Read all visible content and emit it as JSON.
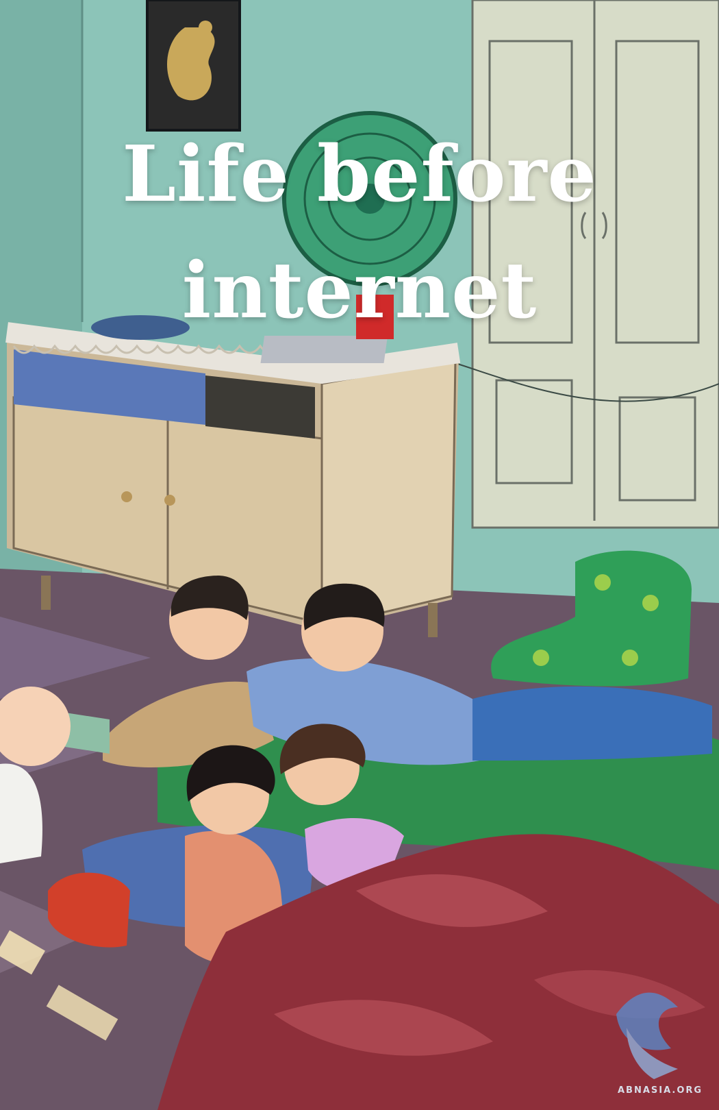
{
  "headline": {
    "line1": "Life before",
    "line2": "internet"
  },
  "watermark": {
    "text": "ABNASIA.ORG"
  },
  "scene": {
    "description_icons": [
      "wall-picture",
      "desk-fan",
      "wardrobe",
      "cabinet",
      "children",
      "blanket"
    ],
    "colors": {
      "wall": "#8cc4b8",
      "floor": "#6a5566",
      "blanket": "#8e2f3a",
      "green_quilt": "#2f8f4e",
      "text": "#ffffff"
    }
  }
}
